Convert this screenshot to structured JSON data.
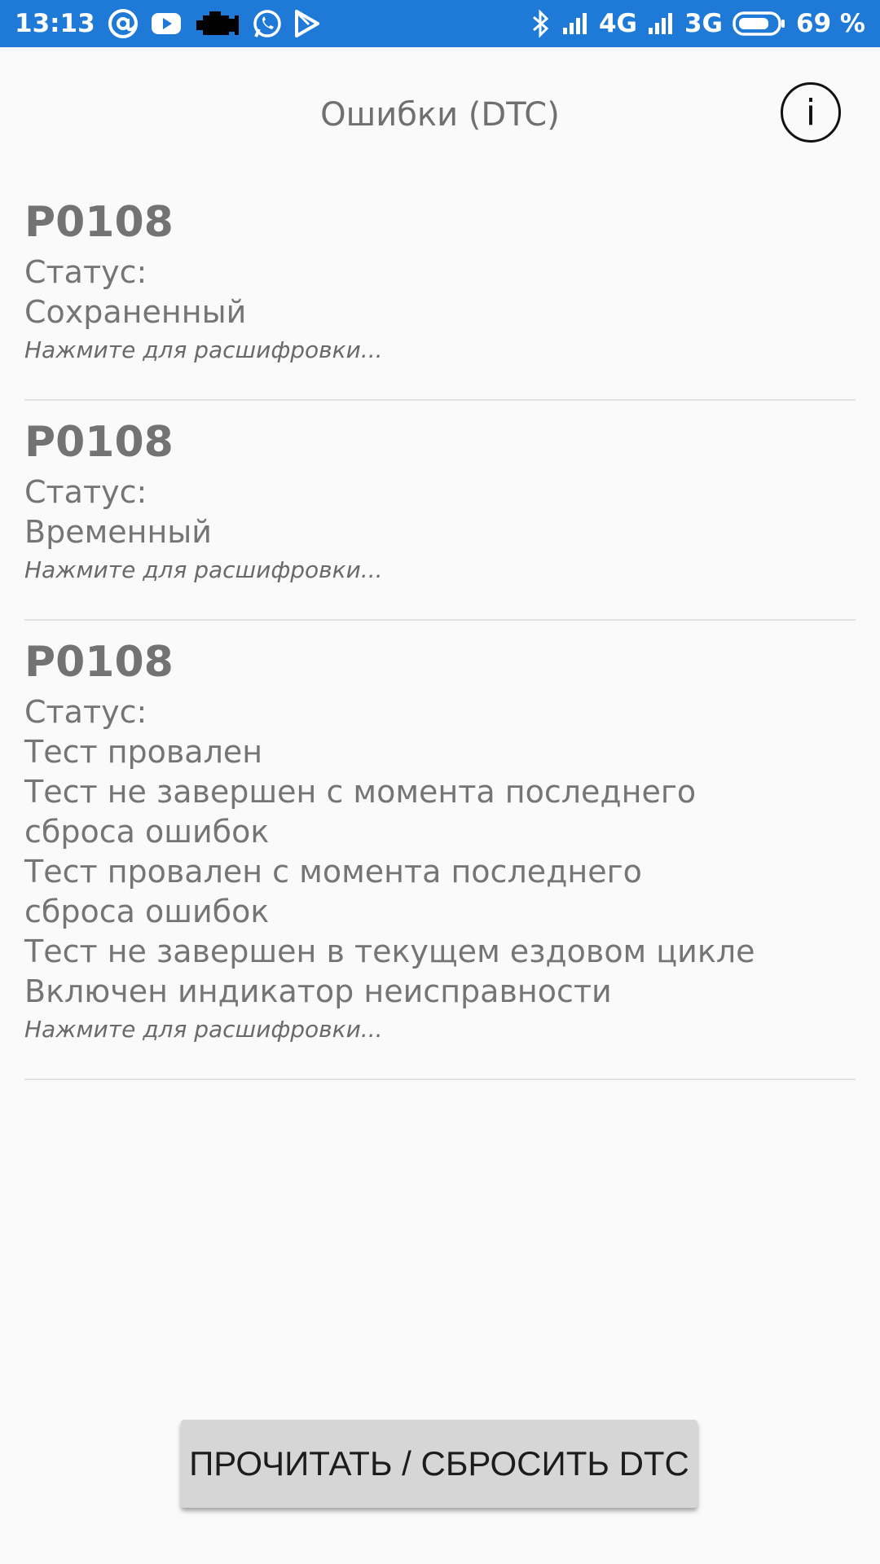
{
  "status_bar": {
    "time": "13:13",
    "network_1": "4G",
    "network_2": "3G",
    "battery": "69 %",
    "icons_left": [
      "at-sign-icon",
      "youtube-icon",
      "engine-icon",
      "whatsapp-icon",
      "play-store-icon"
    ],
    "icons_right": [
      "bluetooth-icon",
      "signal-icon",
      "battery-icon"
    ],
    "background_color": "#1e7ad6"
  },
  "header": {
    "title": "Ошибки (DTC)",
    "info_icon": "i"
  },
  "dtc_items": [
    {
      "code": "P0108",
      "status_label": "Статус:",
      "status_lines": [
        "Сохраненный"
      ],
      "hint": "Нажмите для расшифровки..."
    },
    {
      "code": "P0108",
      "status_label": "Статус:",
      "status_lines": [
        "Временный"
      ],
      "hint": "Нажмите для расшифровки..."
    },
    {
      "code": "P0108",
      "status_label": "Статус:",
      "status_lines": [
        "Тест провален",
        "Тест не завершен с момента последнего",
        "сброса ошибок",
        "Тест провален с момента последнего",
        "сброса ошибок",
        "Тест не завершен в текущем ездовом цикле",
        "Включен индикатор неисправности"
      ],
      "hint": "Нажмите для расшифровки..."
    }
  ],
  "action_button": {
    "label": "ПРОЧИТАТЬ / СБРОСИТЬ DTC"
  }
}
